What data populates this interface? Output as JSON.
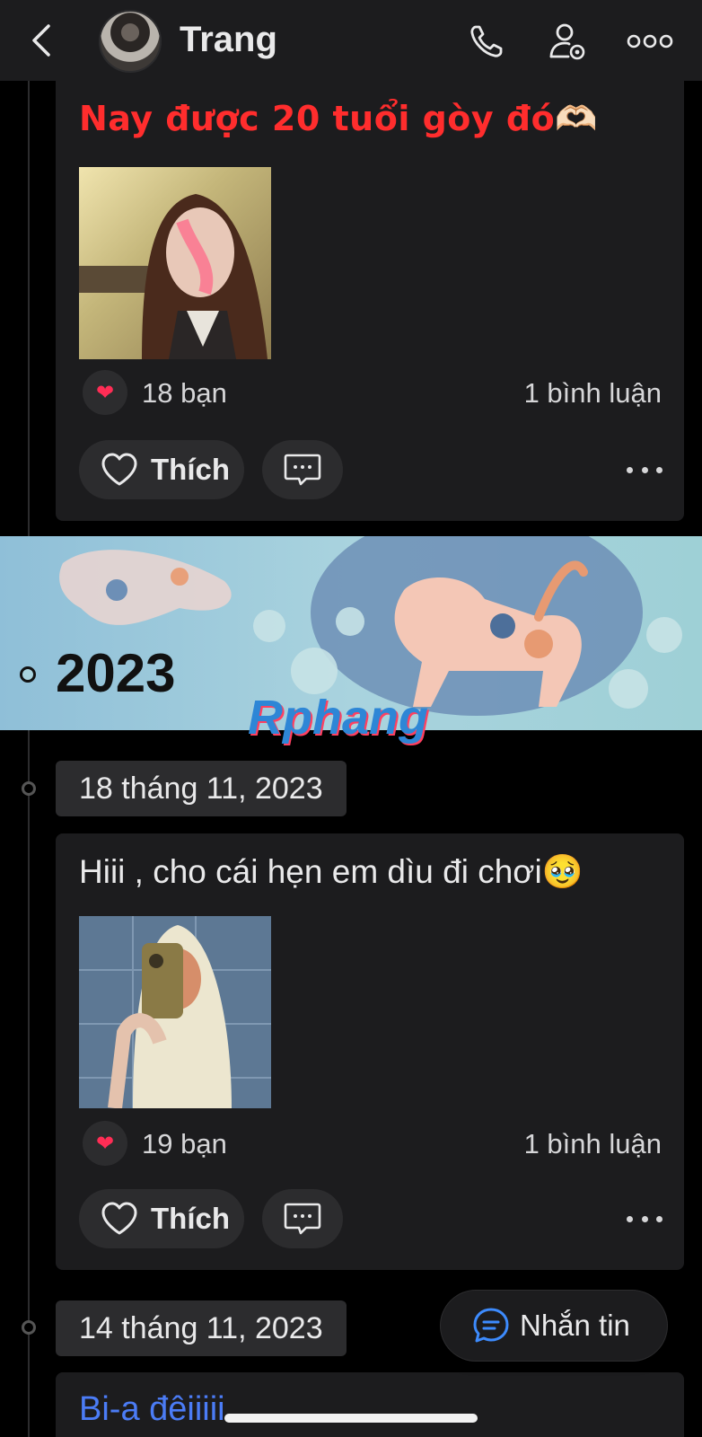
{
  "header": {
    "name": "Trang",
    "back_icon": "chevron-left-icon",
    "actions": [
      "phone-icon",
      "user-settings-icon",
      "more-icon"
    ]
  },
  "posts": [
    {
      "text": "Nay được 20 tuổi gòy đó🫶🏻",
      "text_color": "#ff2d2d",
      "reaction_icon": "heart",
      "reaction_count": "18 bạn",
      "comment_count": "1 bình luận",
      "like_label": "Thích"
    },
    {
      "date": "18 tháng 11, 2023",
      "text": "Hiii , cho cái hẹn em dìu đi chơi🥹",
      "reaction_icon": "heart",
      "reaction_count": "19 bạn",
      "comment_count": "1 bình luận",
      "like_label": "Thích"
    },
    {
      "date": "14 tháng 11, 2023",
      "text": "Bi-a đêiiiii",
      "text_color": "#4b7cf6"
    }
  ],
  "year_banner": {
    "year": "2023",
    "watermark": "Rphang"
  },
  "message_button": {
    "label": "Nhắn tin"
  },
  "colors": {
    "background": "#000000",
    "card": "#1c1c1e",
    "pill": "#2c2c2e",
    "reaction_heart": "#ff2d55",
    "accent_blue": "#4b7cf6"
  }
}
